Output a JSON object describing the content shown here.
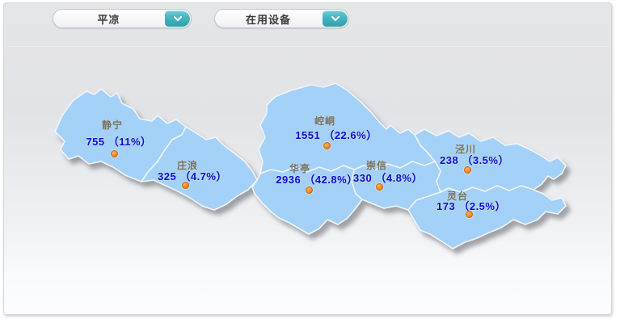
{
  "header": {
    "region_dropdown": {
      "value": "平凉"
    },
    "metric_dropdown": {
      "value": "在用设备"
    }
  },
  "map": {
    "districts": [
      {
        "name": "静宁",
        "value": 755,
        "percent": "11%",
        "value_display": "755 （11%）"
      },
      {
        "name": "庄浪",
        "value": 325,
        "percent": "4.7%",
        "value_display": "325 （4.7%）"
      },
      {
        "name": "崆峒",
        "value": 1551,
        "percent": "22.6%",
        "value_display": "1551 （22.6%）"
      },
      {
        "name": "华亭",
        "value": 2936,
        "percent": "42.8%",
        "value_display": "2936 （42.8%）"
      },
      {
        "name": "崇信",
        "value": 330,
        "percent": "4.8%",
        "value_display": "330 （4.8%）"
      },
      {
        "name": "泾川",
        "value": 238,
        "percent": "3.5%",
        "value_display": "238 （3.5%）"
      },
      {
        "name": "灵台",
        "value": 173,
        "percent": "2.5%",
        "value_display": "173 （2.5%）"
      }
    ]
  },
  "colors": {
    "map_fill": "#a4d1f7",
    "map_border": "#f0f5fc",
    "value_text": "#0a0ad2",
    "district_name_text": "#77705f",
    "marker_dot": "#ee7d17",
    "dropdown_cap_teal": "#46b4c1",
    "panel_gray": "#e4e5e7"
  }
}
